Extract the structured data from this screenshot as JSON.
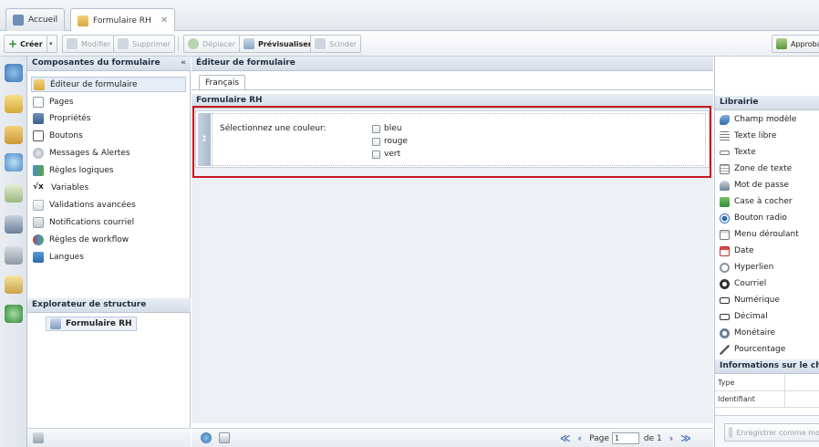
{
  "tabs": [
    {
      "label": "Accueil",
      "icon": "home-icon"
    },
    {
      "label": "Formulaire RH",
      "icon": "form-icon",
      "close": "✕"
    }
  ],
  "toolbar": {
    "create_label": "Créer",
    "modify_label": "Modifier",
    "delete_label": "Supprimer",
    "move_label": "Déplacer",
    "preview_label": "Prévisualiser",
    "split_label": "Scinder",
    "approve_label": "Approba"
  },
  "components": {
    "header": "Composantes du formulaire",
    "collapse": "«",
    "items": [
      {
        "label": "Éditeur de formulaire"
      },
      {
        "label": "Pages"
      },
      {
        "label": "Propriétés"
      },
      {
        "label": "Boutons"
      },
      {
        "label": "Messages & Alertes"
      },
      {
        "label": "Règles logiques"
      },
      {
        "label": "Variables"
      },
      {
        "label": "Validations avancées"
      },
      {
        "label": "Notifications courriel"
      },
      {
        "label": "Règles de workflow"
      },
      {
        "label": "Langues"
      }
    ]
  },
  "structure": {
    "header": "Explorateur de structure",
    "node": "Formulaire RH"
  },
  "editor": {
    "header": "Éditeur de formulaire",
    "lang_tab": "Français",
    "form_title": "Formulaire RH",
    "field_label": "Sélectionnez une couleur:",
    "options": [
      "bleu",
      "rouge",
      "vert"
    ],
    "handle": "↕"
  },
  "pager": {
    "first": "≪",
    "prev": "‹",
    "page_label": "Page",
    "page_value": "1",
    "of_label": "de 1",
    "next": "›",
    "last": "≫"
  },
  "library": {
    "header": "Librairie",
    "items": [
      {
        "label": "Champ modèle"
      },
      {
        "label": "Texte libre"
      },
      {
        "label": "Texte"
      },
      {
        "label": "Zone de texte"
      },
      {
        "label": "Mot de passe"
      },
      {
        "label": "Case à cocher"
      },
      {
        "label": "Bouton radio"
      },
      {
        "label": "Menu déroulant"
      },
      {
        "label": "Date"
      },
      {
        "label": "Hyperlien"
      },
      {
        "label": "Courriel"
      },
      {
        "label": "Numérique"
      },
      {
        "label": "Décimal"
      },
      {
        "label": "Monétaire"
      },
      {
        "label": "Pourcentage"
      }
    ],
    "info_header": "Informations sur le cha",
    "info_rows": [
      {
        "label": "Type"
      },
      {
        "label": "Identifiant"
      }
    ],
    "save_label": "Enregistrer comme mo"
  },
  "colors": {
    "highlight": "#c8191f",
    "accent": "#4a73b5"
  }
}
